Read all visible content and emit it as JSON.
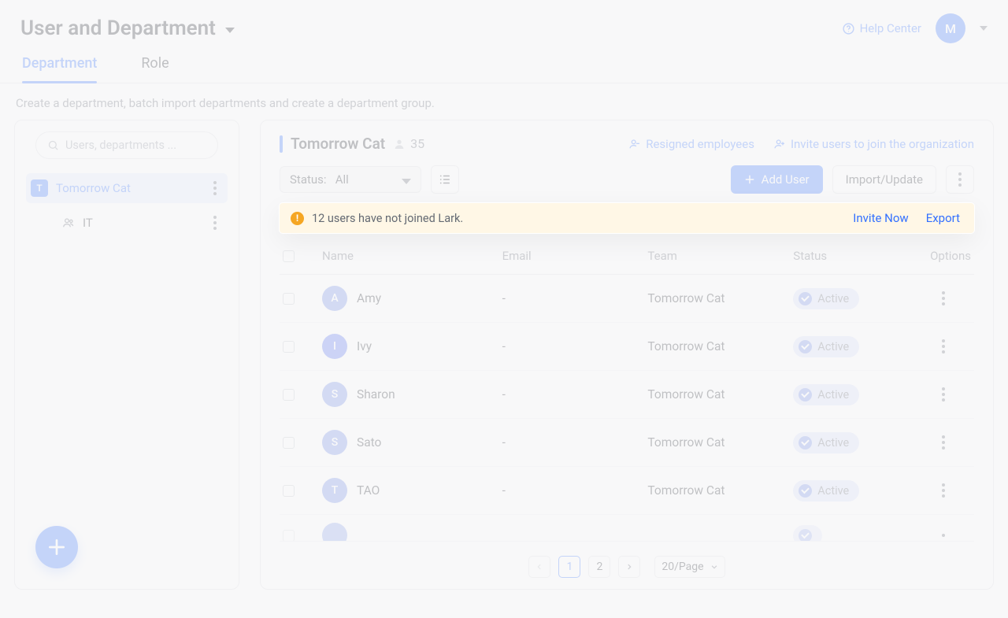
{
  "header": {
    "title": "User and Department",
    "help_label": "Help Center",
    "avatar_initial": "M"
  },
  "tabs": {
    "department": "Department",
    "role": "Role"
  },
  "subtext": "Create a department, batch import departments and create a department group.",
  "sidebar": {
    "search_placeholder": "Users, departments ...",
    "root": {
      "badge": "T",
      "label": "Tomorrow Cat"
    },
    "child": {
      "label": "IT"
    }
  },
  "main": {
    "dept_name": "Tomorrow Cat",
    "member_count": "35",
    "links": {
      "resigned": "Resigned employees",
      "invite_org": "Invite users to join the organization"
    },
    "status_filter": {
      "prefix": "Status:",
      "value": "All"
    },
    "buttons": {
      "add_user": "Add User",
      "import": "Import/Update"
    }
  },
  "banner": {
    "message": "12 users have not joined Lark.",
    "invite": "Invite Now",
    "export": "Export"
  },
  "table": {
    "cols": {
      "name": "Name",
      "email": "Email",
      "team": "Team",
      "status": "Status",
      "options": "Options"
    },
    "rows": [
      {
        "initial": "A",
        "color": "#6b88e6",
        "name": "Amy",
        "email": "-",
        "team": "Tomorrow Cat",
        "status": "Active"
      },
      {
        "initial": "I",
        "color": "#4f6ef1",
        "name": "Ivy",
        "email": "-",
        "team": "Tomorrow Cat",
        "status": "Active"
      },
      {
        "initial": "S",
        "color": "#6b88e6",
        "name": "Sharon",
        "email": "-",
        "team": "Tomorrow Cat",
        "status": "Active"
      },
      {
        "initial": "S",
        "color": "#6b88e6",
        "name": "Sato",
        "email": "-",
        "team": "Tomorrow Cat",
        "status": "Active"
      },
      {
        "initial": "T",
        "color": "#6b88e6",
        "name": "TAO",
        "email": "-",
        "team": "Tomorrow Cat",
        "status": "Active"
      }
    ]
  },
  "pagination": {
    "page1": "1",
    "page2": "2",
    "per_page": "20/Page"
  }
}
